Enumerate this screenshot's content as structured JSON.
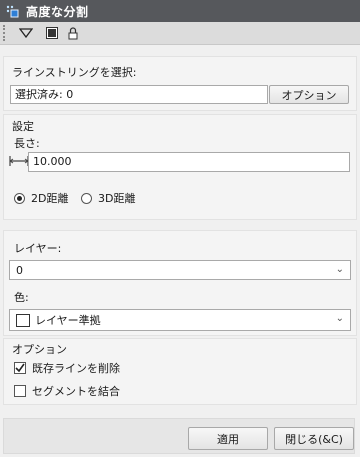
{
  "window": {
    "title": "高度な分割",
    "title_icon": "divide-tool-icon"
  },
  "toolbar": {
    "icons": [
      "dropdown-triangle-icon",
      "image-icon",
      "lock-icon"
    ]
  },
  "selection": {
    "heading": "ラインストリングを選択:",
    "status_value": "選択済み: 0",
    "options_button": "オプション"
  },
  "settings": {
    "heading": "設定",
    "length_label": "長さ:",
    "length_value": "10.000",
    "radio_2d": "2D距離",
    "radio_3d": "3D距離",
    "selected_mode": "2D"
  },
  "layer": {
    "label": "レイヤー:",
    "value": "0",
    "color_label": "色:",
    "color_value": "レイヤー準拠",
    "color_swatch": "#ffffff"
  },
  "options": {
    "heading": "オプション",
    "delete_existing": "既存ラインを削除",
    "delete_existing_checked": true,
    "join_segments": "セグメントを結合",
    "join_segments_checked": false
  },
  "footer": {
    "apply": "適用",
    "close": "閉じる(&C)"
  },
  "colors": {
    "titlebar": "#56585c",
    "toolbar": "#dcdcdc",
    "background": "#f0f0f0"
  }
}
